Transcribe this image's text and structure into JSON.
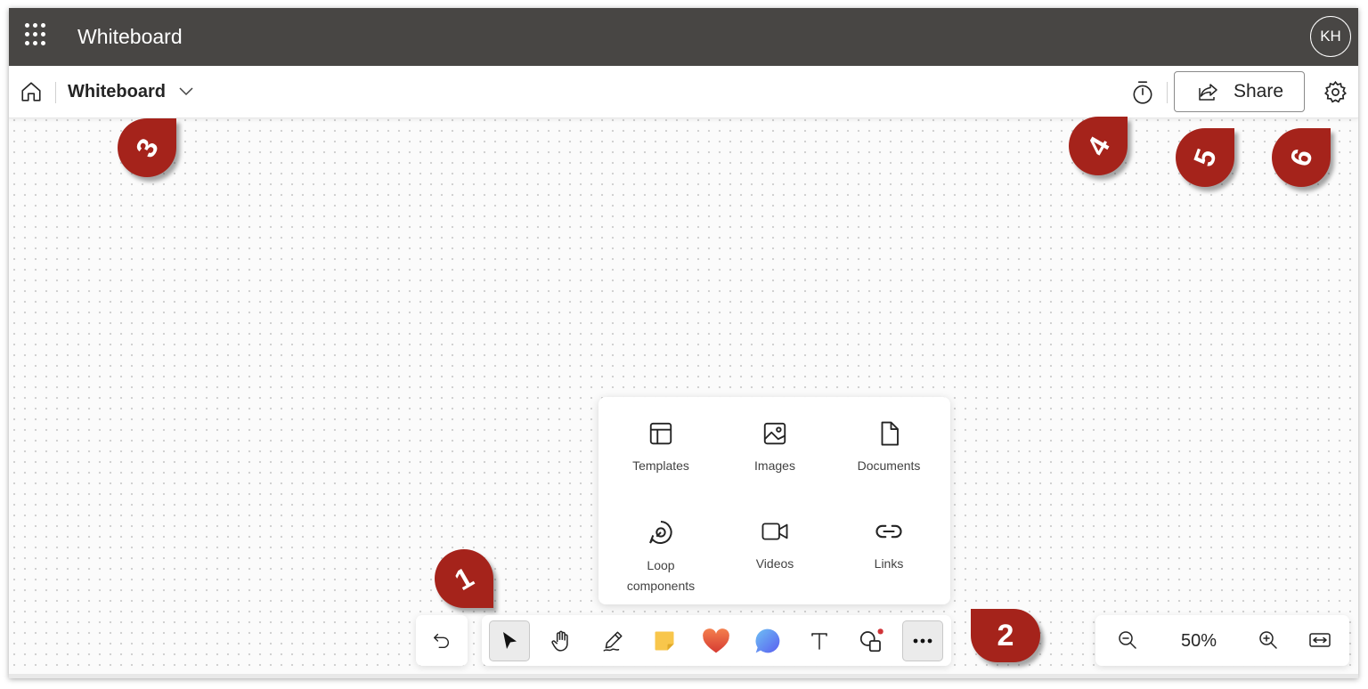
{
  "appbar": {
    "title": "Whiteboard",
    "avatar_initials": "KH"
  },
  "header": {
    "board_name": "Whiteboard",
    "share_label": "Share"
  },
  "insert_menu": {
    "items": [
      {
        "label": "Templates",
        "icon": "templates-icon"
      },
      {
        "label": "Images",
        "icon": "image-icon"
      },
      {
        "label": "Documents",
        "icon": "document-icon"
      },
      {
        "label": "Loop components",
        "icon": "loop-icon"
      },
      {
        "label": "Videos",
        "icon": "video-icon"
      },
      {
        "label": "Links",
        "icon": "link-icon"
      }
    ]
  },
  "toolbar": {
    "tools": [
      {
        "name": "select",
        "icon": "pointer-icon",
        "active": true
      },
      {
        "name": "pan",
        "icon": "hand-icon"
      },
      {
        "name": "pen",
        "icon": "pen-icon"
      },
      {
        "name": "sticky-note",
        "icon": "sticky-note-icon"
      },
      {
        "name": "reactions",
        "icon": "heart-icon"
      },
      {
        "name": "comment",
        "icon": "comment-icon"
      },
      {
        "name": "text",
        "icon": "text-icon"
      },
      {
        "name": "shapes",
        "icon": "shapes-icon"
      },
      {
        "name": "more",
        "icon": "more-icon",
        "active": true
      }
    ]
  },
  "zoom": {
    "level": "50%"
  },
  "markers": [
    "1",
    "2",
    "3",
    "4",
    "5",
    "6"
  ],
  "colors": {
    "appbar": "#484644",
    "marker": "#a5231b",
    "sticky": "#f8c64b",
    "heart": "#e8553f",
    "comment": "#5a8cf0",
    "notification_dot": "#d13438"
  }
}
